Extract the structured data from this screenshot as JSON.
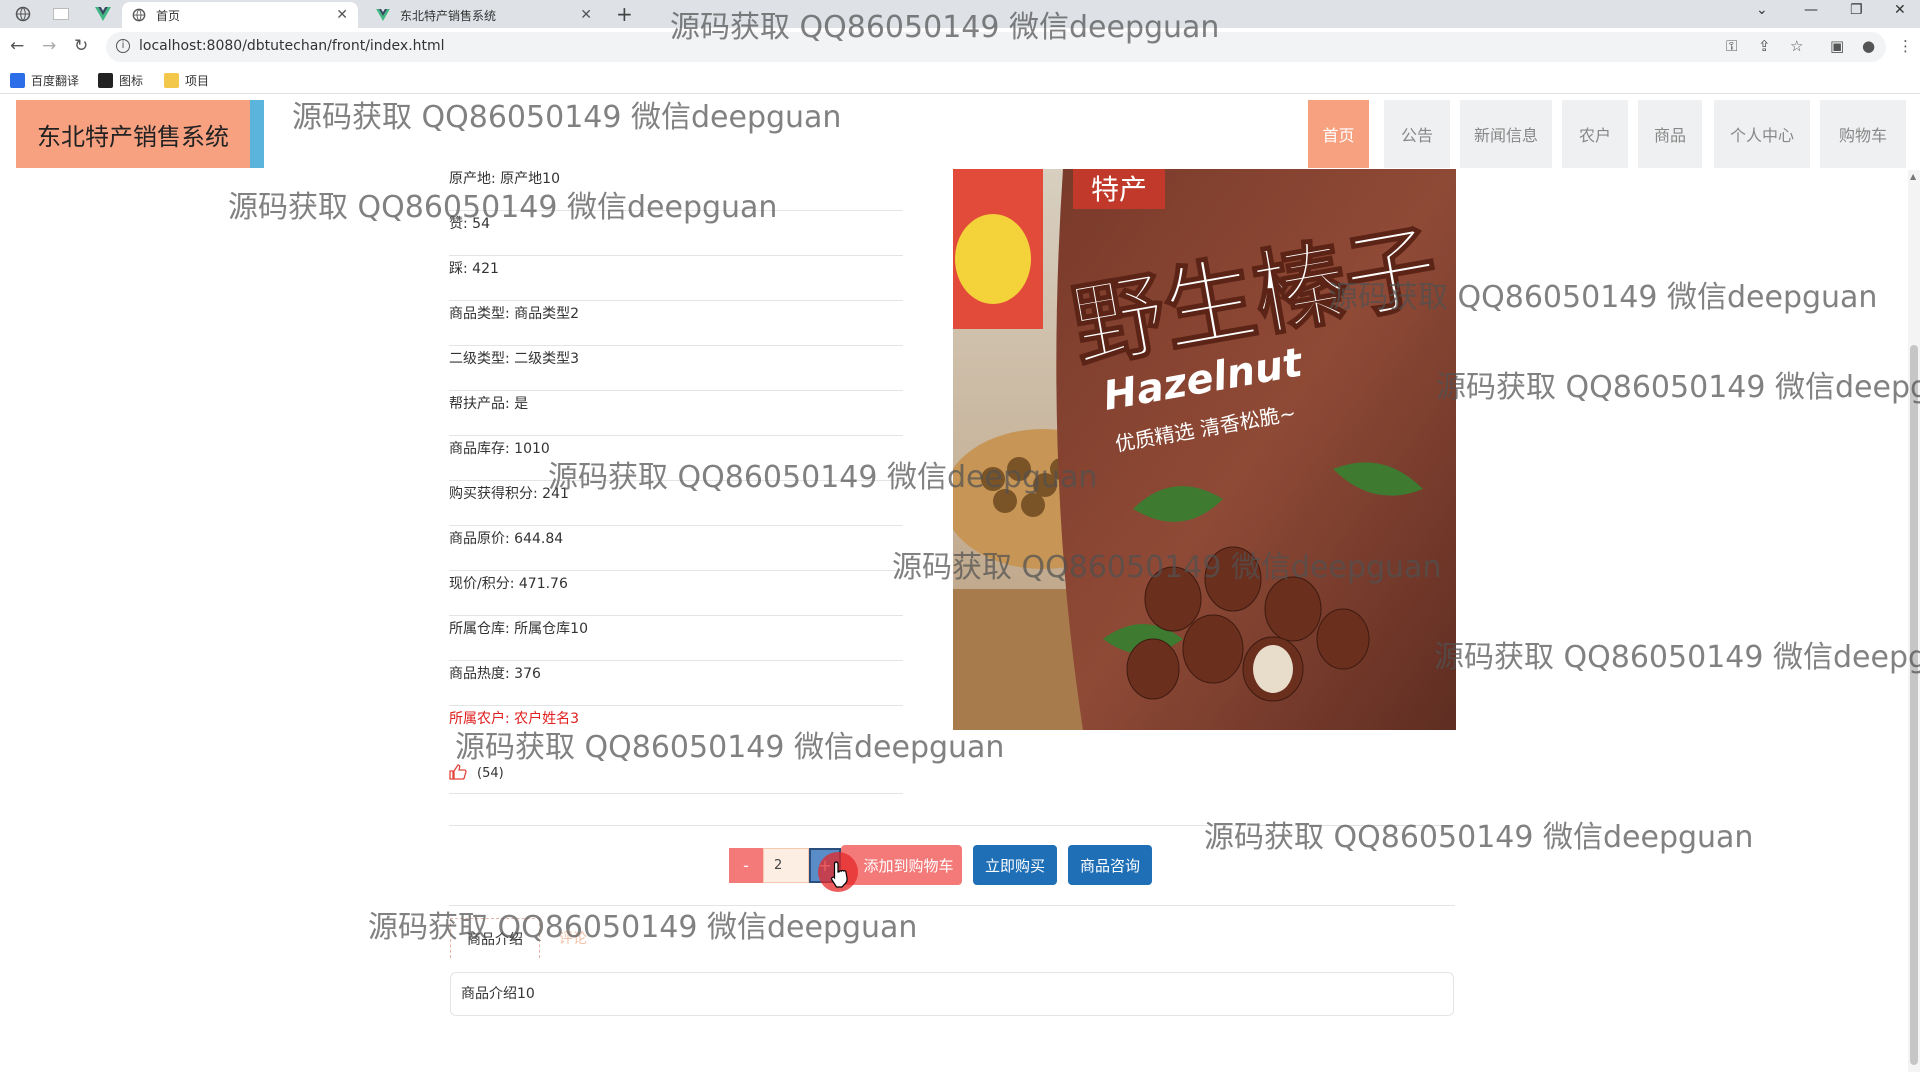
{
  "browser": {
    "tabs": [
      {
        "title": "首页",
        "active": true
      },
      {
        "title": "东北特产销售系统",
        "active": false
      }
    ],
    "url": "localhost:8080/dbtutechan/front/index.html",
    "bookmarks": [
      "百度翻译",
      "图标",
      "项目"
    ]
  },
  "site": {
    "logo": "东北特产销售系统",
    "nav": [
      "首页",
      "公告",
      "新闻信息",
      "农户",
      "商品",
      "个人中心",
      "购物车"
    ],
    "nav_active": "首页"
  },
  "product": {
    "details": [
      "原产地: 原产地10",
      "赞: 54",
      "踩: 421",
      "商品类型: 商品类型2",
      "二级类型: 二级类型3",
      "帮扶产品: 是",
      "商品库存: 1010",
      "购买获得积分: 241",
      "商品原价: 644.84",
      "现价/积分: 471.76",
      "所属仓库: 所属仓库10",
      "商品热度: 376",
      "所属农户: 农户姓名3"
    ],
    "like_count": "(54)",
    "image_text": {
      "badge": "特产",
      "title": "野生榛子",
      "english": "Hazelnut",
      "slogan": "优质精选 清香松脆~"
    }
  },
  "purchase": {
    "minus": "-",
    "quantity": "2",
    "plus": "+",
    "add_to_cart": "添加到购物车",
    "buy_now": "立即购买",
    "consult": "商品咨询"
  },
  "tabs": {
    "intro_label": "商品介绍",
    "comment_label": "评论",
    "intro_text": "商品介绍10"
  },
  "watermark": "源码获取 QQ86050149 微信deepguan",
  "colors": {
    "logo_bg": "#f7a181",
    "logo_accent": "#5ab4dc",
    "cart_btn": "#f47a7a",
    "primary_btn": "#1f6fb7",
    "farmer_text": "#e02020"
  }
}
